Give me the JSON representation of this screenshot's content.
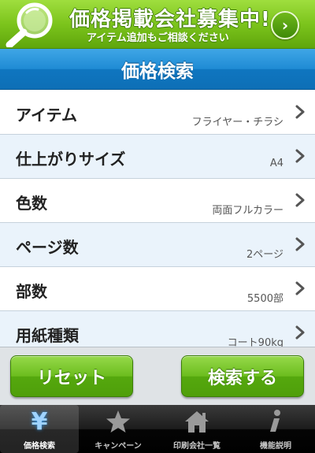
{
  "banner": {
    "title": "価格掲載会社募集中!",
    "subtitle": "アイテム追加もご相談ください",
    "arrow": "›"
  },
  "header": {
    "title": "価格検索"
  },
  "search_items": [
    {
      "label": "アイテム",
      "value": "フライヤー・チラシ"
    },
    {
      "label": "仕上がりサイズ",
      "value": "A4"
    },
    {
      "label": "色数",
      "value": "両面フルカラー"
    },
    {
      "label": "ページ数",
      "value": "2ページ"
    },
    {
      "label": "部数",
      "value": "5500部"
    },
    {
      "label": "用紙種類",
      "value": "コート90kg"
    }
  ],
  "buttons": {
    "reset": "リセット",
    "search": "検索する"
  },
  "tabs": [
    {
      "label": "価格検索",
      "icon": "yen-icon",
      "glyph": "¥"
    },
    {
      "label": "キャンペーン",
      "icon": "star-icon"
    },
    {
      "label": "印刷会社一覧",
      "icon": "home-icon"
    },
    {
      "label": "機能説明",
      "icon": "info-icon"
    }
  ],
  "colors": {
    "banner_green": "#7cc41c",
    "title_blue": "#1f8bd4",
    "button_green": "#6cbd1e",
    "tabbar_black": "#1c1c1c"
  }
}
